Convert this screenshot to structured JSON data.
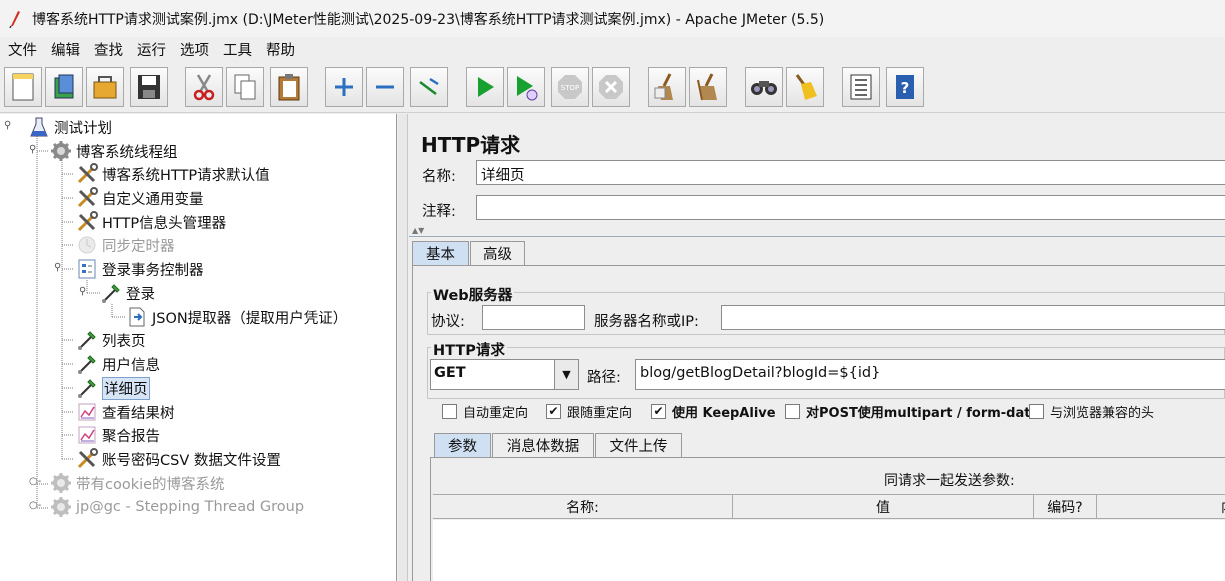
{
  "window": {
    "title": "博客系统HTTP请求测试案例.jmx (D:\\JMeter性能测试\\2025-09-23\\博客系统HTTP请求测试案例.jmx) - Apache JMeter (5.5)"
  },
  "menu": [
    "文件",
    "编辑",
    "查找",
    "运行",
    "选项",
    "工具",
    "帮助"
  ],
  "toolbar": [
    "new-icon",
    "templates-icon",
    "open-icon",
    "save-icon",
    "cut-icon",
    "copy-icon",
    "paste-icon",
    "expand-icon",
    "collapse-icon",
    "toggle-icon",
    "start-icon",
    "start-no-pause-icon",
    "stop-icon",
    "shutdown-icon",
    "clear-icon",
    "clear-all-icon",
    "search-icon",
    "reset-search-icon",
    "function-helper-icon",
    "help-icon"
  ],
  "tree": [
    {
      "label": "测试计划",
      "icon": "test-plan-icon",
      "disabled": false
    },
    {
      "label": "博客系统线程组",
      "icon": "thread-group-icon",
      "disabled": false
    },
    {
      "label": "博客系统HTTP请求默认值",
      "icon": "config-element-icon",
      "disabled": false
    },
    {
      "label": "自定义通用变量",
      "icon": "config-element-icon",
      "disabled": false
    },
    {
      "label": "HTTP信息头管理器",
      "icon": "config-element-icon",
      "disabled": false
    },
    {
      "label": "同步定时器",
      "icon": "timer-icon",
      "disabled": true
    },
    {
      "label": "登录事务控制器",
      "icon": "transaction-controller-icon",
      "disabled": false
    },
    {
      "label": "登录",
      "icon": "sampler-icon",
      "disabled": false
    },
    {
      "label": "JSON提取器（提取用户凭证）",
      "icon": "post-processor-icon",
      "disabled": false
    },
    {
      "label": "列表页",
      "icon": "sampler-icon",
      "disabled": false
    },
    {
      "label": "用户信息",
      "icon": "sampler-icon",
      "disabled": false
    },
    {
      "label": "详细页",
      "icon": "sampler-icon",
      "disabled": false,
      "selected": true
    },
    {
      "label": "查看结果树",
      "icon": "listener-icon",
      "disabled": false
    },
    {
      "label": "聚合报告",
      "icon": "listener-icon",
      "disabled": false
    },
    {
      "label": "账号密码CSV 数据文件设置",
      "icon": "config-element-icon",
      "disabled": false
    },
    {
      "label": "带有cookie的博客系统",
      "icon": "thread-group-icon",
      "disabled": true
    },
    {
      "label": "jp@gc - Stepping Thread Group",
      "icon": "thread-group-icon",
      "disabled": true
    }
  ],
  "panel": {
    "heading": "HTTP请求",
    "name_label": "名称:",
    "name_value": "详细页",
    "comment_label": "注释:",
    "comment_value": "",
    "tabs": [
      "基本",
      "高级"
    ],
    "web_server": {
      "title": "Web服务器",
      "protocol_label": "协议:",
      "protocol_value": "",
      "server_label": "服务器名称或IP:",
      "server_value": ""
    },
    "http_request": {
      "title": "HTTP请求",
      "method": "GET",
      "path_label": "路径:",
      "path_value": "blog/getBlogDetail?blogId=${id}"
    },
    "checkboxes": [
      {
        "label": "自动重定向",
        "checked": false
      },
      {
        "label": "跟随重定向",
        "checked": true
      },
      {
        "label": "使用 KeepAlive",
        "checked": true
      },
      {
        "label": "对POST使用multipart / form-data",
        "checked": false
      },
      {
        "label": "与浏览器兼容的头",
        "checked": false
      }
    ],
    "subtabs": [
      "参数",
      "消息体数据",
      "文件上传"
    ],
    "params_caption": "同请求一起发送参数:",
    "columns": [
      "名称:",
      "值",
      "编码?",
      "内"
    ]
  }
}
